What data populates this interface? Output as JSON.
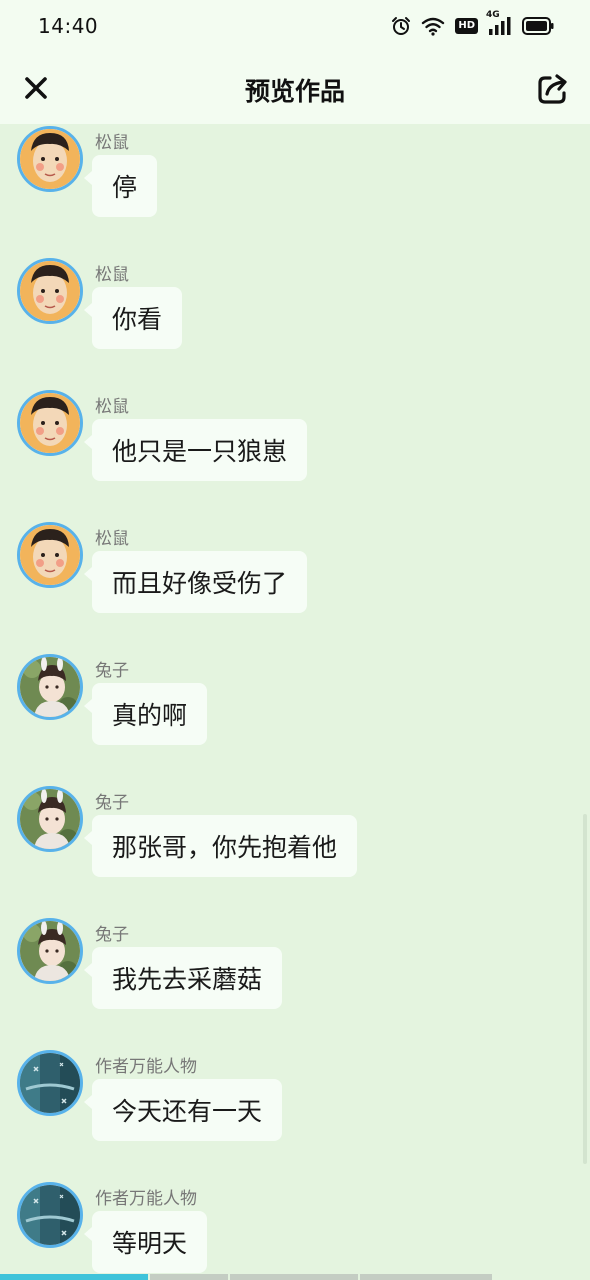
{
  "status_bar": {
    "time": "14:40",
    "icons": [
      "alarm-icon",
      "wifi-icon",
      "hd-badge",
      "signal-4g-icon",
      "battery-icon"
    ],
    "hd_label": "HD",
    "network_label": "4G"
  },
  "header": {
    "title": "预览作品",
    "close_icon": "close-icon",
    "share_icon": "share-icon"
  },
  "messages": [
    {
      "sender": "松鼠",
      "text": "停",
      "avatar": "squirrel"
    },
    {
      "sender": "松鼠",
      "text": "你看",
      "avatar": "squirrel"
    },
    {
      "sender": "松鼠",
      "text": "他只是一只狼崽",
      "avatar": "squirrel"
    },
    {
      "sender": "松鼠",
      "text": "而且好像受伤了",
      "avatar": "squirrel"
    },
    {
      "sender": "兔子",
      "text": "真的啊",
      "avatar": "rabbit"
    },
    {
      "sender": "兔子",
      "text": "那张哥，你先抱着他",
      "avatar": "rabbit"
    },
    {
      "sender": "兔子",
      "text": "我先去采蘑菇",
      "avatar": "rabbit"
    },
    {
      "sender": "作者万能人物",
      "text": "今天还有一天",
      "avatar": "author"
    },
    {
      "sender": "作者万能人物",
      "text": "等明天",
      "avatar": "author"
    }
  ],
  "progress": {
    "fraction": 0.25
  },
  "colors": {
    "background": "#e4f4df",
    "bar_background": "#f3fcf1",
    "bubble": "#f6fdf6",
    "avatar_border": "#58b2ea",
    "progress_fill": "#3ec3da"
  }
}
